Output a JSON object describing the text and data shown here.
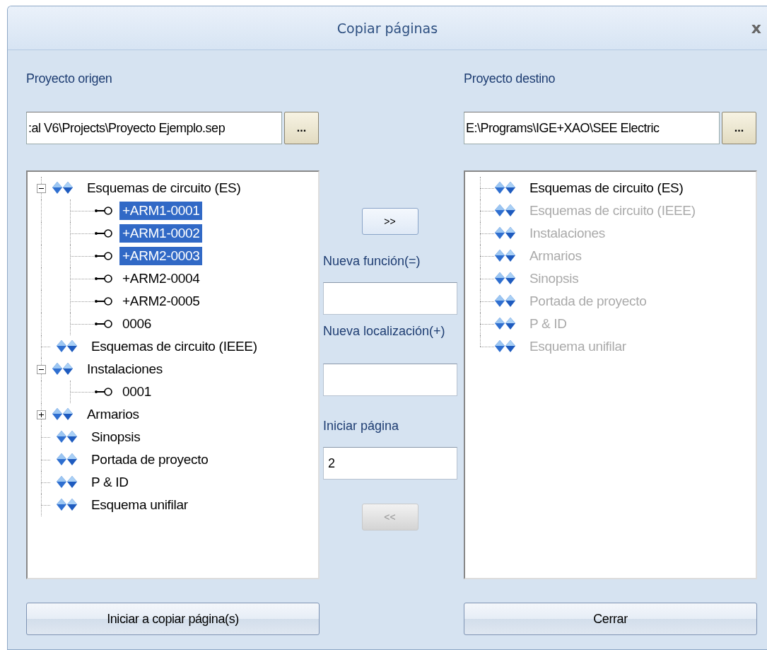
{
  "window": {
    "title": "Copiar páginas",
    "close": "x"
  },
  "source": {
    "label": "Proyecto origen",
    "path": ":al V6\\Projects\\Proyecto Ejemplo.sep",
    "browse": "..."
  },
  "destination": {
    "label": "Proyecto destino",
    "path": "E:\\Programs\\IGE+XAO\\SEE Electric",
    "browse": "..."
  },
  "source_tree": [
    {
      "label": "Esquemas de circuito (ES)",
      "kind": "expanded-group",
      "selected": false,
      "children": [
        {
          "label": "+ARM1-0001",
          "kind": "page",
          "selected": true
        },
        {
          "label": "+ARM1-0002",
          "kind": "page",
          "selected": true
        },
        {
          "label": "+ARM2-0003",
          "kind": "page",
          "selected": true
        },
        {
          "label": "+ARM2-0004",
          "kind": "page",
          "selected": false
        },
        {
          "label": "+ARM2-0005",
          "kind": "page",
          "selected": false
        },
        {
          "label": "0006",
          "kind": "page",
          "selected": false
        }
      ]
    },
    {
      "label": "Esquemas de circuito (IEEE)",
      "kind": "group",
      "selected": false
    },
    {
      "label": "Instalaciones",
      "kind": "expanded-group",
      "selected": false,
      "children": [
        {
          "label": "0001",
          "kind": "page",
          "selected": false
        }
      ]
    },
    {
      "label": "Armarios",
      "kind": "collapsed-group",
      "selected": false
    },
    {
      "label": "Sinopsis",
      "kind": "group",
      "selected": false
    },
    {
      "label": "Portada de proyecto",
      "kind": "group",
      "selected": false
    },
    {
      "label": "P & ID",
      "kind": "group",
      "selected": false
    },
    {
      "label": "Esquema unifilar",
      "kind": "group",
      "selected": false
    }
  ],
  "middle": {
    "copy_button": {
      "label": ">>",
      "disabled": false
    },
    "new_function": {
      "label": "Nueva función(=)"
    },
    "new_location": {
      "label": "Nueva localización(+)"
    },
    "start_page": {
      "label": "Iniciar página",
      "value": "2"
    },
    "back_button": {
      "label": "<<",
      "disabled": true
    }
  },
  "destination_tree": [
    {
      "label": "Esquemas de circuito (ES)",
      "disabled": false
    },
    {
      "label": "Esquemas de circuito (IEEE)",
      "disabled": true
    },
    {
      "label": "Instalaciones",
      "disabled": true
    },
    {
      "label": "Armarios",
      "disabled": true
    },
    {
      "label": "Sinopsis",
      "disabled": true
    },
    {
      "label": "Portada de proyecto",
      "disabled": true
    },
    {
      "label": "P & ID",
      "disabled": true
    },
    {
      "label": "Esquema unifilar",
      "disabled": true
    }
  ],
  "buttons": {
    "start": "Iniciar a copiar página(s)",
    "close": "Cerrar"
  }
}
